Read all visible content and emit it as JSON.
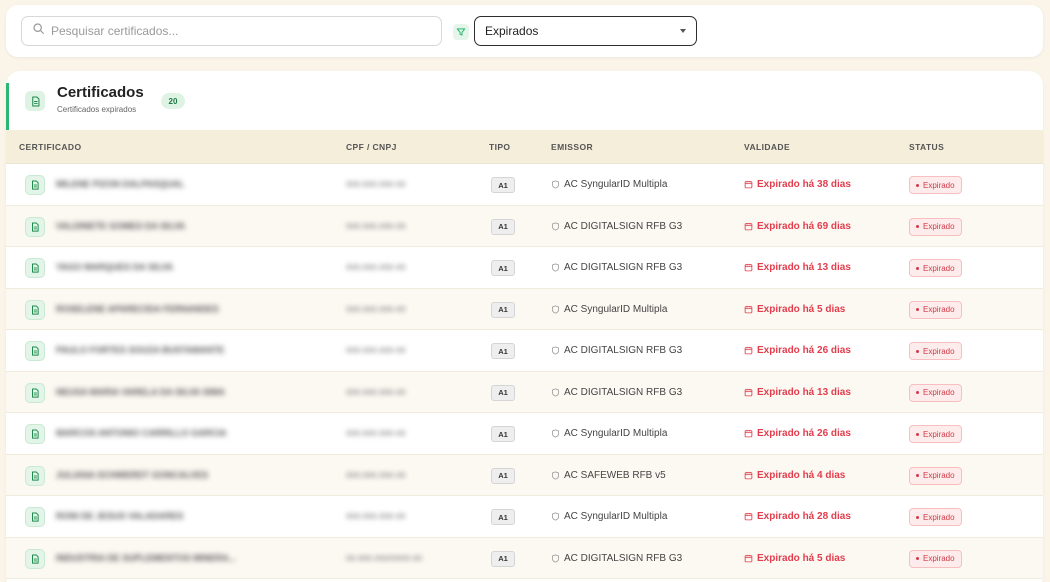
{
  "search": {
    "placeholder": "Pesquisar certificados...",
    "value": ""
  },
  "filter": {
    "selected": "Expirados"
  },
  "card": {
    "title": "Certificados",
    "subtitle": "Certificados expirados",
    "count": "20"
  },
  "columns": {
    "certificado": "CERTIFICADO",
    "documento": "CPF / CNPJ",
    "tipo": "TIPO",
    "emissor": "EMISSOR",
    "validade": "VALIDADE",
    "status": "STATUS"
  },
  "rows": [
    {
      "name": "MILENE PIZON DALPASQUAL",
      "doc": "000.000.000-00",
      "tipo": "A1",
      "emissor": "AC SyngularID Multipla",
      "validade": "Expirado há 38 dias",
      "status": "Expirado"
    },
    {
      "name": "VALDINETE GOMES DA SILVA",
      "doc": "000.000.000-00",
      "tipo": "A1",
      "emissor": "AC DIGITALSIGN RFB G3",
      "validade": "Expirado há 69 dias",
      "status": "Expirado"
    },
    {
      "name": "YAGO MARQUES DA SILVA",
      "doc": "000.000.000-00",
      "tipo": "A1",
      "emissor": "AC DIGITALSIGN RFB G3",
      "validade": "Expirado há 13 dias",
      "status": "Expirado"
    },
    {
      "name": "ROSELENE APARECIDA FERNANDES",
      "doc": "000.000.000-00",
      "tipo": "A1",
      "emissor": "AC SyngularID Multipla",
      "validade": "Expirado há 5 dias",
      "status": "Expirado"
    },
    {
      "name": "PAULO FORTES SOUZA BUSTAMANTE",
      "doc": "000.000.000-00",
      "tipo": "A1",
      "emissor": "AC DIGITALSIGN RFB G3",
      "validade": "Expirado há 26 dias",
      "status": "Expirado"
    },
    {
      "name": "NEUSA MARIA VARELA DA SILVA SIMA",
      "doc": "000.000.000-00",
      "tipo": "A1",
      "emissor": "AC DIGITALSIGN RFB G3",
      "validade": "Expirado há 13 dias",
      "status": "Expirado"
    },
    {
      "name": "MARCOS ANTONIO CARRILLO GARCIA",
      "doc": "000.000.000-00",
      "tipo": "A1",
      "emissor": "AC SyngularID Multipla",
      "validade": "Expirado há 26 dias",
      "status": "Expirado"
    },
    {
      "name": "JULIANA SCHWERDT GONCALVES",
      "doc": "000.000.000-00",
      "tipo": "A1",
      "emissor": "AC SAFEWEB RFB v5",
      "validade": "Expirado há 4 dias",
      "status": "Expirado"
    },
    {
      "name": "RONI DE JESUS VALADARES",
      "doc": "000.000.000-00",
      "tipo": "A1",
      "emissor": "AC SyngularID Multipla",
      "validade": "Expirado há 28 dias",
      "status": "Expirado"
    },
    {
      "name": "INDUSTRIA DE SUPLEMENTOS MINERA...",
      "doc": "00.000.000/0000-00",
      "tipo": "A1",
      "emissor": "AC DIGITALSIGN RFB G3",
      "validade": "Expirado há 5 dias",
      "status": "Expirado"
    }
  ],
  "colors": {
    "accent": "#2bb673",
    "danger": "#e23d4d",
    "header_bg": "#f5eedb",
    "page_bg": "#fbf5e9"
  },
  "icons": {
    "search": "search-icon",
    "filter": "filter-icon",
    "certificate": "document-icon",
    "issuer": "shield-icon",
    "date": "calendar-icon"
  }
}
